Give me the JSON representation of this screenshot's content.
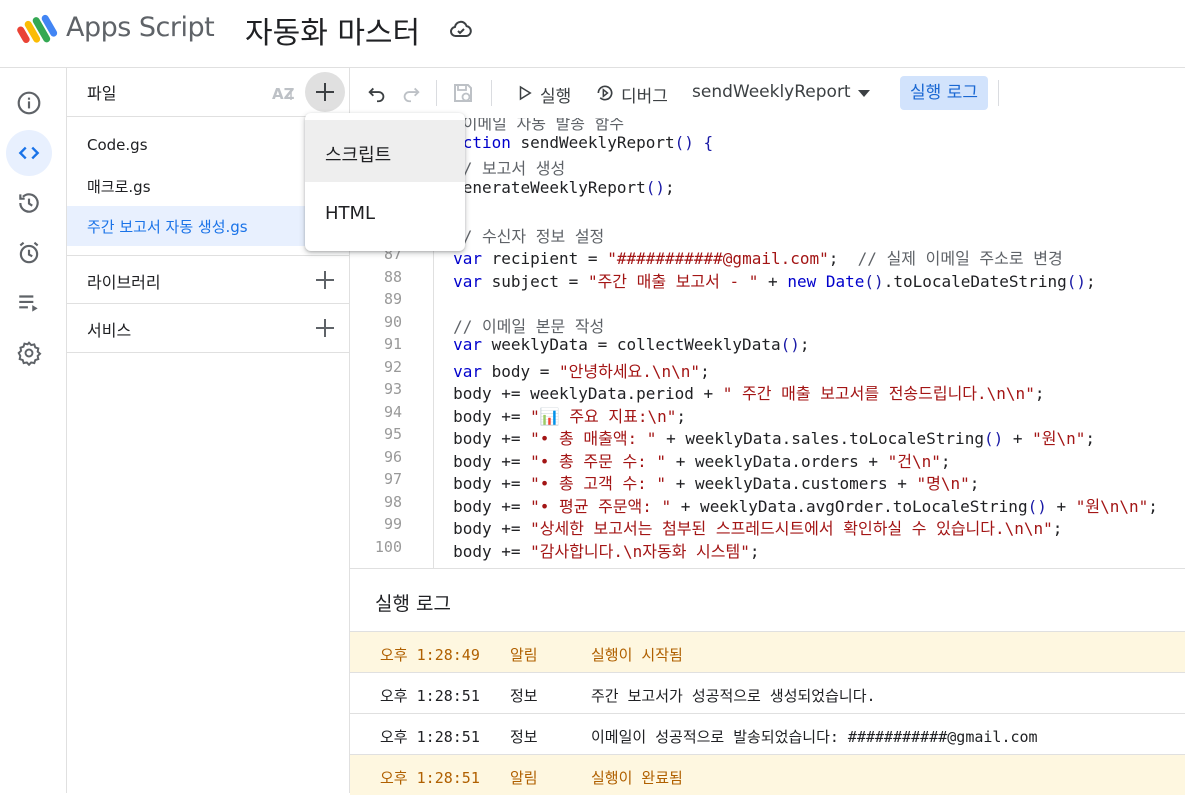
{
  "app": {
    "name": "Apps Script",
    "project_title": "자동화 마스터"
  },
  "rail": [
    "info-icon",
    "code-icon",
    "history-icon",
    "alarm-icon",
    "executions-icon",
    "settings-icon"
  ],
  "files_panel": {
    "files_label": "파일",
    "sort_label": "AZ",
    "files": [
      "Code.gs",
      "매크로.gs",
      "주간 보고서 자동 생성.gs"
    ],
    "selected_file": "주간 보고서 자동 생성.gs",
    "libraries_label": "라이브러리",
    "services_label": "서비스"
  },
  "new_menu": {
    "items": [
      "스크립트",
      "HTML"
    ]
  },
  "toolbar": {
    "run_label": "실행",
    "debug_label": "디버그",
    "function_select": "sendWeeklyReport",
    "exec_log_label": "실행 로그"
  },
  "editor": {
    "line_numbers": [
      "",
      "",
      "",
      "",
      "",
      "",
      "87",
      "88",
      "89",
      "90",
      "91",
      "92",
      "93",
      "94",
      "95",
      "96",
      "97",
      "98",
      "99",
      "100"
    ],
    "lines": [
      "// 이메일 자동 발송 함수",
      "function sendWeeklyReport() {",
      "  // 보고서 생성",
      "  generateWeeklyReport();",
      "",
      "  // 수신자 정보 설정",
      "  var recipient = \"###########@gmail.com\";  // 실제 이메일 주소로 변경",
      "  var subject = \"주간 매출 보고서 - \" + new Date().toLocaleDateString();",
      "",
      "  // 이메일 본문 작성",
      "  var weeklyData = collectWeeklyData();",
      "  var body = \"안녕하세요.\\n\\n\";",
      "  body += weeklyData.period + \" 주간 매출 보고서를 전송드립니다.\\n\\n\";",
      "  body += \"📊 주요 지표:\\n\";",
      "  body += \"• 총 매출액: \" + weeklyData.sales.toLocaleString() + \"원\\n\";",
      "  body += \"• 총 주문 수: \" + weeklyData.orders + \"건\\n\";",
      "  body += \"• 총 고객 수: \" + weeklyData.customers + \"명\\n\";",
      "  body += \"• 평균 주문액: \" + weeklyData.avgOrder.toLocaleString() + \"원\\n\\n\";",
      "  body += \"상세한 보고서는 첨부된 스프레드시트에서 확인하실 수 있습니다.\\n\\n\";",
      "  body += \"감사합니다.\\n자동화 시스템\";"
    ]
  },
  "log": {
    "title": "실행 로그",
    "rows": [
      {
        "time": "오후 1:28:49",
        "level": "알림",
        "message": "실행이 시작됨",
        "kind": "notice"
      },
      {
        "time": "오후 1:28:51",
        "level": "정보",
        "message": "주간 보고서가 성공적으로 생성되었습니다.",
        "kind": "info"
      },
      {
        "time": "오후 1:28:51",
        "level": "정보",
        "message": "이메일이 성공적으로 발송되었습니다: ###########@gmail.com",
        "kind": "info"
      },
      {
        "time": "오후 1:28:51",
        "level": "알림",
        "message": "실행이 완료됨",
        "kind": "notice"
      }
    ]
  },
  "colors": {
    "accent": "#1a73e8",
    "selected_bg": "#e8f0fe",
    "notice_bg": "#fef7e0",
    "notice_text": "#b06000",
    "keyword": "#0000cc",
    "string": "#a31515"
  }
}
